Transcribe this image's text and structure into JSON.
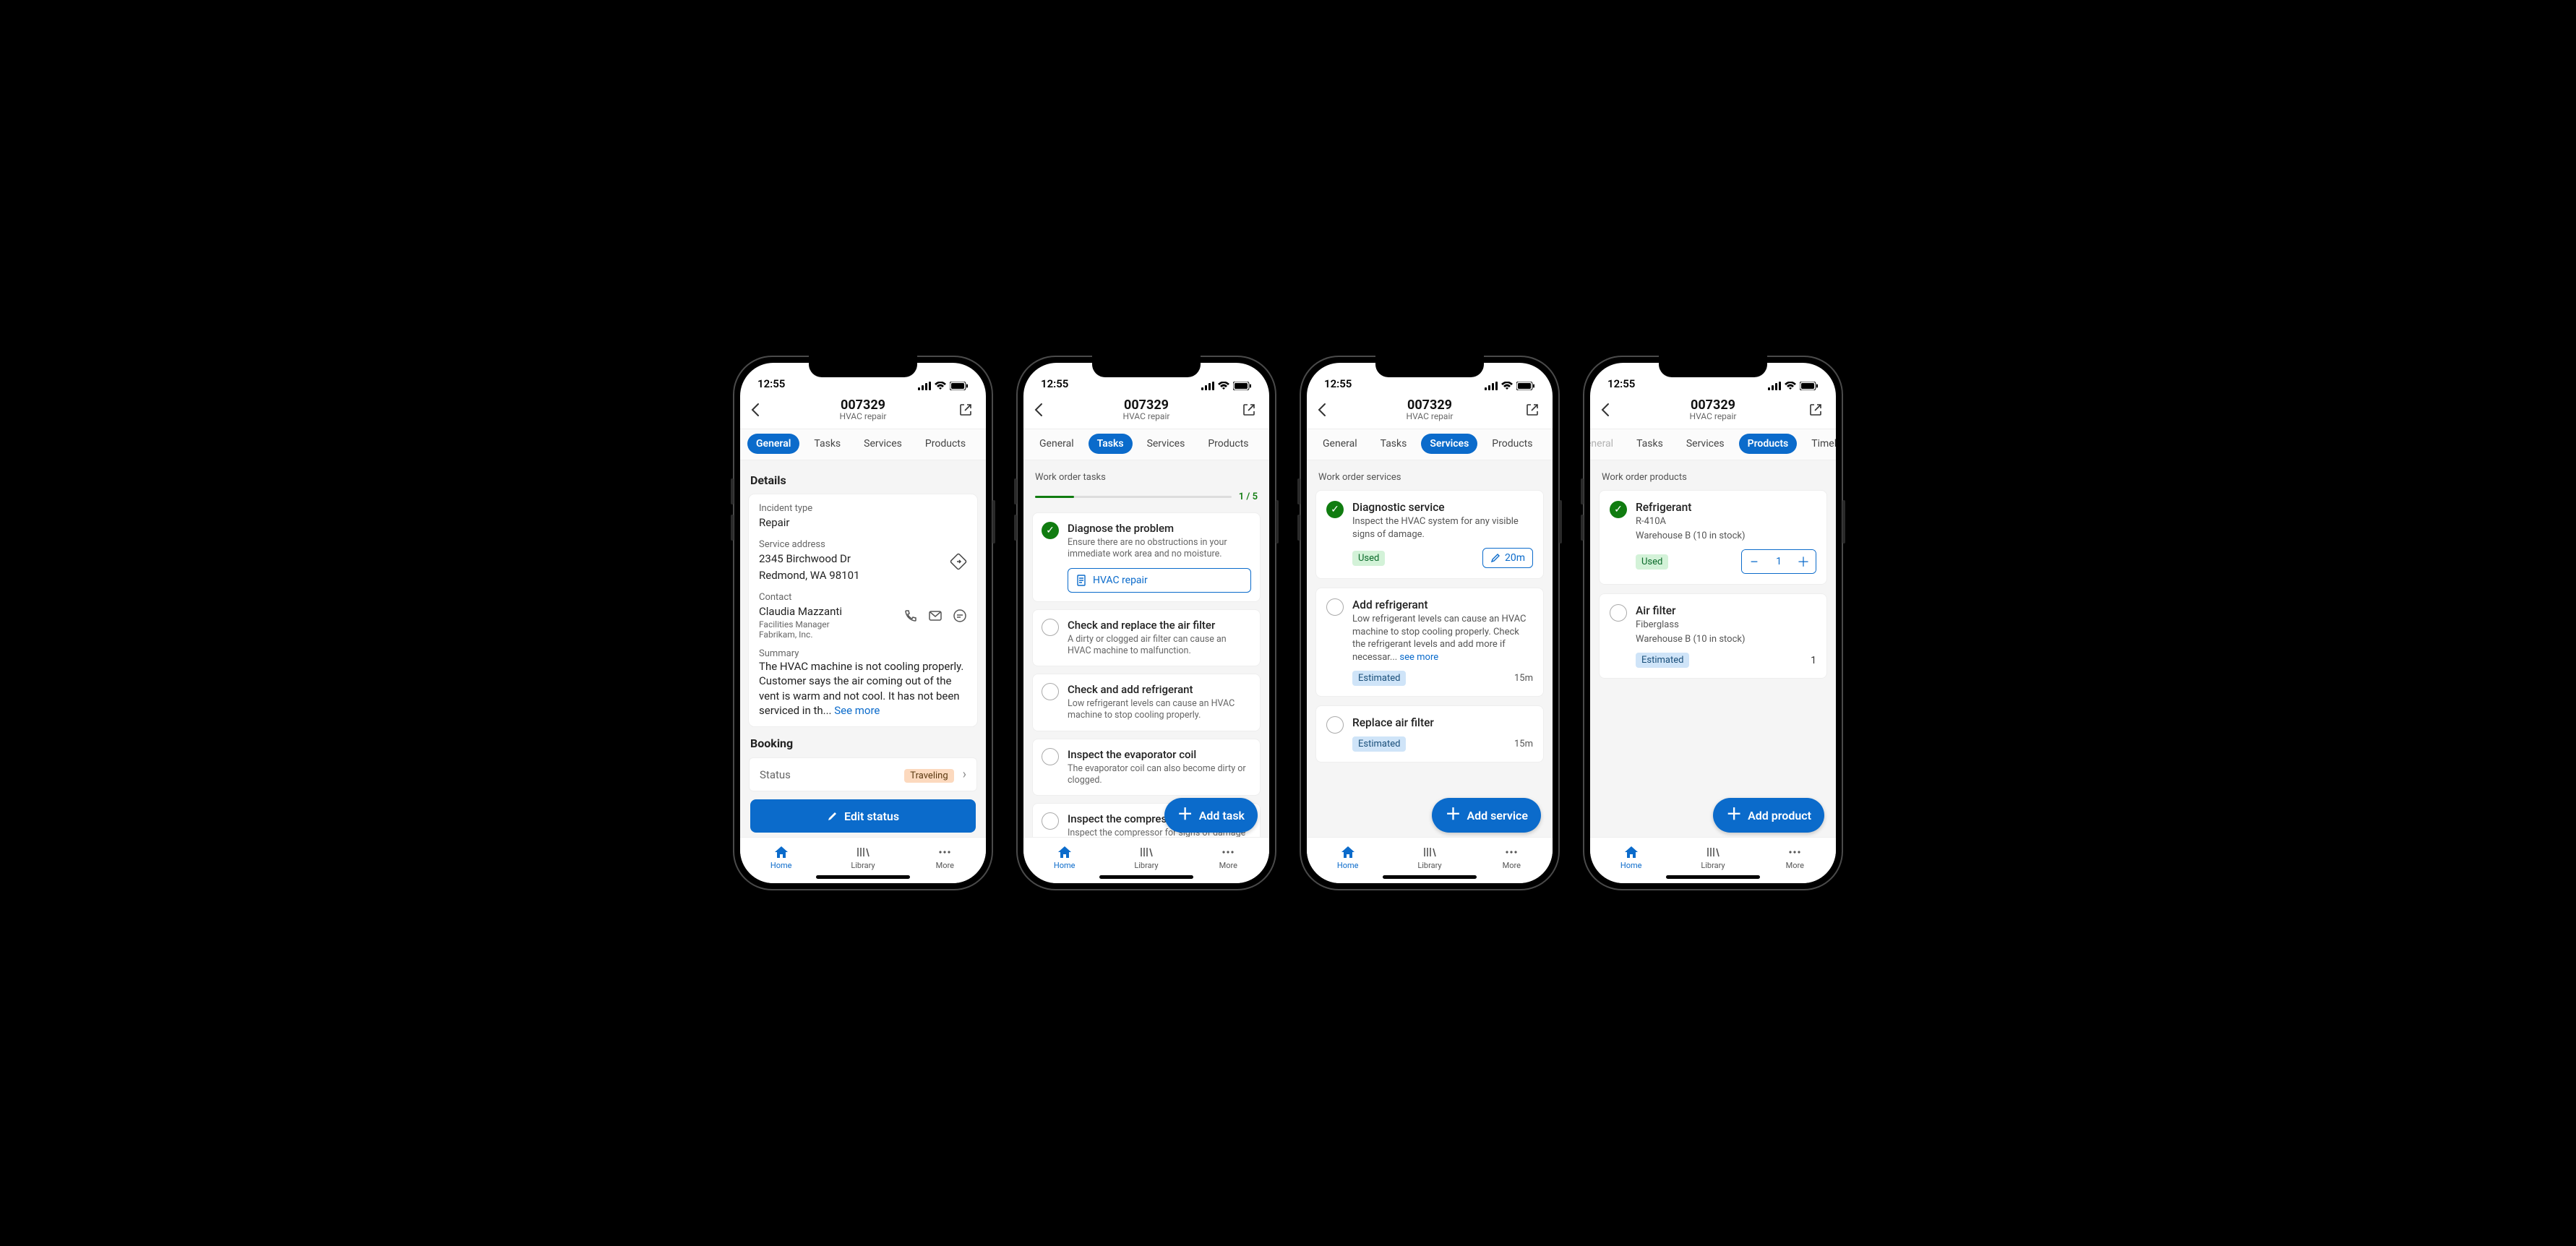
{
  "status_bar": {
    "time": "12:55"
  },
  "header": {
    "title": "007329",
    "subtitle": "HVAC repair"
  },
  "tabs": [
    "General",
    "Tasks",
    "Services",
    "Products",
    "Timeline"
  ],
  "bottom_nav": {
    "home": "Home",
    "library": "Library",
    "more": "More"
  },
  "general": {
    "details_title": "Details",
    "incident_type_label": "Incident type",
    "incident_type": "Repair",
    "service_address_label": "Service address",
    "service_address_line1": "2345 Birchwood Dr",
    "service_address_line2": "Redmond, WA 98101",
    "contact_label": "Contact",
    "contact_name": "Claudia Mazzanti",
    "contact_title": "Facilities Manager",
    "contact_company": "Fabrikam, Inc.",
    "summary_label": "Summary",
    "summary": "The HVAC machine is not cooling properly. Customer says the air coming out of the vent is warm and not cool. It has not been serviced in th... ",
    "see_more": "See more",
    "booking_title": "Booking",
    "status_label": "Status",
    "status_value": "Traveling",
    "edit_status_button": "Edit status"
  },
  "tasks": {
    "section_label": "Work order tasks",
    "progress_text": "1 / 5",
    "progress_pct": 20,
    "items": [
      {
        "title": "Diagnose the problem",
        "desc": "Ensure there are no obstructions in your immediate work area and no moisture.",
        "attachment": "HVAC repair"
      },
      {
        "title": "Check and replace the air filter",
        "desc": "A dirty or clogged air filter can cause an HVAC machine to malfunction."
      },
      {
        "title": "Check and add refrigerant",
        "desc": "Low refrigerant levels can cause an HVAC machine to stop cooling properly."
      },
      {
        "title": "Inspect the evaporator coil",
        "desc": "The evaporator coil can also become dirty or clogged."
      },
      {
        "title": "Inspect the compressor",
        "desc": "Inspect the compressor for signs of damage or wear."
      }
    ],
    "add_button": "Add task"
  },
  "services": {
    "section_label": "Work order services",
    "items": [
      {
        "title": "Diagnostic service",
        "desc": "Inspect the HVAC system for any visible signs of damage.",
        "status": "Used",
        "duration": "20m"
      },
      {
        "title": "Add refrigerant",
        "desc": "Low refrigerant levels can cause an HVAC machine to stop cooling properly. Check the refrigerant levels and add more if necessar... ",
        "see_more": "see more",
        "status": "Estimated",
        "duration": "15m"
      },
      {
        "title": "Replace air filter",
        "status": "Estimated",
        "duration": "15m"
      }
    ],
    "add_button": "Add service"
  },
  "products": {
    "section_label": "Work order products",
    "items": [
      {
        "title": "Refrigerant",
        "sub1": "R-410A",
        "sub2": "Warehouse B (10 in stock)",
        "status": "Used",
        "qty": "1"
      },
      {
        "title": "Air filter",
        "sub1": "Fiberglass",
        "sub2": "Warehouse B (10 in stock)",
        "status": "Estimated",
        "qty": "1"
      }
    ],
    "add_button": "Add product"
  }
}
